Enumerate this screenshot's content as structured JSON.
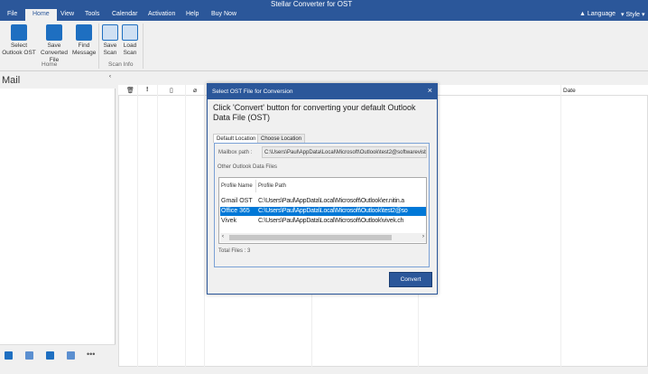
{
  "app": {
    "title": "Stellar Converter for OST"
  },
  "menu": [
    "File",
    "Home",
    "View",
    "Tools",
    "Calendar",
    "Activation",
    "Help",
    "Buy Now"
  ],
  "right_menu": {
    "language": "Language",
    "style": "Style"
  },
  "ribbon": {
    "buttons": [
      {
        "label1": "Select",
        "label2": "Outlook OST"
      },
      {
        "label1": "Save",
        "label2": "Converted File"
      },
      {
        "label1": "Find",
        "label2": "Message"
      },
      {
        "label1": "Save",
        "label2": "Scan"
      },
      {
        "label1": "Load",
        "label2": "Scan"
      }
    ],
    "groups": {
      "home": "Home",
      "scan": "Scan Info"
    }
  },
  "sidebar": {
    "title": "Mail"
  },
  "columns": {
    "date": "Date"
  },
  "dialog": {
    "title": "Select OST File for Conversion",
    "instruction": "Click 'Convert' button for converting your default Outlook Data File (OST)",
    "tabs": [
      "Default Location",
      "Choose Location"
    ],
    "mailbox_label": "Mailbox path :",
    "mailbox_path": "C:\\Users\\Paul\\AppData\\Local\\Microsoft\\Outlook\\test2@softwarevisb",
    "other_label": "Other Outlook Data Files",
    "list_headers": [
      "Profile Name",
      "Profile Path"
    ],
    "rows": [
      {
        "name": "Gmail OST",
        "path": "C:\\Users\\Paul\\AppData\\Local\\Microsoft\\Outlook\\er.nitin.a"
      },
      {
        "name": "Office 365",
        "path": "C:\\Users\\Paul\\AppData\\Local\\Microsoft\\Outlook\\test2@so"
      },
      {
        "name": "Vivek",
        "path": "C:\\Users\\Paul\\AppData\\Local\\Microsoft\\Outlook\\vivek.ch"
      }
    ],
    "total": "Total Files : 3",
    "convert": "Convert"
  }
}
